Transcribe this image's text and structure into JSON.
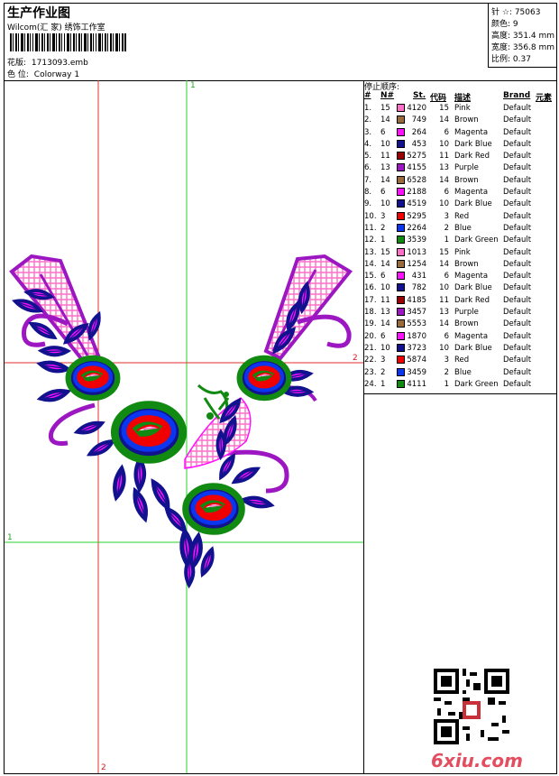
{
  "header": {
    "title": "生产作业图",
    "company": "Wilcom(汇 家) 绣饰工作室",
    "design_label": "花版:",
    "design_value": "1713093.emb",
    "colorway_label": "色 位:",
    "colorway_value": "Colorway 1"
  },
  "stats": {
    "stitches": "针 ☆: 75063",
    "colors": "颜色: 9",
    "height": "高度: 351.4 mm",
    "width": "宽度: 356.8 mm",
    "scale": "比例: 0.37"
  },
  "canvas": {
    "v1_label": "1",
    "h2_label": "2",
    "h1_label": "1",
    "v2_label": "2"
  },
  "sequence": {
    "title": "停止顺序:",
    "headers": {
      "idx": "#",
      "n": "N#",
      "st": "St.",
      "code": "代码",
      "desc": "描述",
      "brand": "Brand",
      "elem": "元素"
    },
    "rows": [
      {
        "idx": "1.",
        "n": "15",
        "color": "#ff6fc8",
        "st": "4120",
        "code": "15",
        "desc": "Pink",
        "brand": "Default"
      },
      {
        "idx": "2.",
        "n": "14",
        "color": "#9a6a3a",
        "st": "749",
        "code": "14",
        "desc": "Brown",
        "brand": "Default"
      },
      {
        "idx": "3.",
        "n": "6",
        "color": "#ff10ff",
        "st": "264",
        "code": "6",
        "desc": "Magenta",
        "brand": "Default"
      },
      {
        "idx": "4.",
        "n": "10",
        "color": "#12128f",
        "st": "453",
        "code": "10",
        "desc": "Dark Blue",
        "brand": "Default"
      },
      {
        "idx": "5.",
        "n": "11",
        "color": "#9b0000",
        "st": "5275",
        "code": "11",
        "desc": "Dark Red",
        "brand": "Default"
      },
      {
        "idx": "6.",
        "n": "13",
        "color": "#9c17c2",
        "st": "4155",
        "code": "13",
        "desc": "Purple",
        "brand": "Default"
      },
      {
        "idx": "7.",
        "n": "14",
        "color": "#9a6a3a",
        "st": "6528",
        "code": "14",
        "desc": "Brown",
        "brand": "Default"
      },
      {
        "idx": "8.",
        "n": "6",
        "color": "#ff10ff",
        "st": "2188",
        "code": "6",
        "desc": "Magenta",
        "brand": "Default"
      },
      {
        "idx": "9.",
        "n": "10",
        "color": "#12128f",
        "st": "4519",
        "code": "10",
        "desc": "Dark Blue",
        "brand": "Default"
      },
      {
        "idx": "10.",
        "n": "3",
        "color": "#f00000",
        "st": "5295",
        "code": "3",
        "desc": "Red",
        "brand": "Default"
      },
      {
        "idx": "11.",
        "n": "2",
        "color": "#0a36f0",
        "st": "2264",
        "code": "2",
        "desc": "Blue",
        "brand": "Default"
      },
      {
        "idx": "12.",
        "n": "1",
        "color": "#118a11",
        "st": "3539",
        "code": "1",
        "desc": "Dark Green",
        "brand": "Default"
      },
      {
        "idx": "13.",
        "n": "15",
        "color": "#ff6fc8",
        "st": "1013",
        "code": "15",
        "desc": "Pink",
        "brand": "Default"
      },
      {
        "idx": "14.",
        "n": "14",
        "color": "#9a6a3a",
        "st": "1254",
        "code": "14",
        "desc": "Brown",
        "brand": "Default"
      },
      {
        "idx": "15.",
        "n": "6",
        "color": "#ff10ff",
        "st": "431",
        "code": "6",
        "desc": "Magenta",
        "brand": "Default"
      },
      {
        "idx": "16.",
        "n": "10",
        "color": "#12128f",
        "st": "782",
        "code": "10",
        "desc": "Dark Blue",
        "brand": "Default"
      },
      {
        "idx": "17.",
        "n": "11",
        "color": "#9b0000",
        "st": "4185",
        "code": "11",
        "desc": "Dark Red",
        "brand": "Default"
      },
      {
        "idx": "18.",
        "n": "13",
        "color": "#9c17c2",
        "st": "3457",
        "code": "13",
        "desc": "Purple",
        "brand": "Default"
      },
      {
        "idx": "19.",
        "n": "14",
        "color": "#9a6a3a",
        "st": "5553",
        "code": "14",
        "desc": "Brown",
        "brand": "Default"
      },
      {
        "idx": "20.",
        "n": "6",
        "color": "#ff10ff",
        "st": "1870",
        "code": "6",
        "desc": "Magenta",
        "brand": "Default"
      },
      {
        "idx": "21.",
        "n": "10",
        "color": "#12128f",
        "st": "3723",
        "code": "10",
        "desc": "Dark Blue",
        "brand": "Default"
      },
      {
        "idx": "22.",
        "n": "3",
        "color": "#f00000",
        "st": "5874",
        "code": "3",
        "desc": "Red",
        "brand": "Default"
      },
      {
        "idx": "23.",
        "n": "2",
        "color": "#0a36f0",
        "st": "3459",
        "code": "2",
        "desc": "Blue",
        "brand": "Default"
      },
      {
        "idx": "24.",
        "n": "1",
        "color": "#118a11",
        "st": "4111",
        "code": "1",
        "desc": "Dark Green",
        "brand": "Default"
      }
    ]
  },
  "watermark": "6xiu.com",
  "icons": {
    "qr": "qr-code-icon",
    "barcode": "barcode-icon"
  }
}
